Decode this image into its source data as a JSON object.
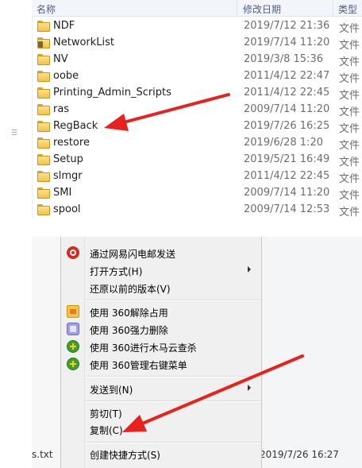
{
  "explorer": {
    "columns": {
      "name": "名称",
      "date": "修改日期",
      "type": "类型"
    },
    "rows": [
      {
        "name": "NDF",
        "date": "2019/7/12 21:36",
        "type": "文件"
      },
      {
        "name": "NetworkList",
        "date": "2019/7/14 11:20",
        "type": "文件",
        "locked": true
      },
      {
        "name": "NV",
        "date": "2019/3/8 15:36",
        "type": "文件"
      },
      {
        "name": "oobe",
        "date": "2011/4/12 22:47",
        "type": "文件"
      },
      {
        "name": "Printing_Admin_Scripts",
        "date": "2011/4/12 22:45",
        "type": "文件"
      },
      {
        "name": "ras",
        "date": "2009/7/14 11:20",
        "type": "文件"
      },
      {
        "name": "RegBack",
        "date": "2019/7/26 16:25",
        "type": "文件"
      },
      {
        "name": "restore",
        "date": "2019/6/28 1:20",
        "type": "文件"
      },
      {
        "name": "Setup",
        "date": "2019/5/21 16:49",
        "type": "文件"
      },
      {
        "name": "slmgr",
        "date": "2011/4/12 22:45",
        "type": "文件"
      },
      {
        "name": "SMI",
        "date": "2009/7/14 11:20",
        "type": "文件"
      },
      {
        "name": "spool",
        "date": "2009/7/14 12:53",
        "type": "文件"
      }
    ]
  },
  "context_menu": {
    "items": [
      {
        "label": "通过网易闪电邮发送",
        "icon": "netease-mail-icon"
      },
      {
        "label": "打开方式(H)",
        "submenu": true
      },
      {
        "label": "还原以前的版本(V)"
      },
      {
        "label": "使用 360解除占用",
        "icon": "unlock-icon"
      },
      {
        "label": "使用 360强力删除",
        "icon": "shred-icon"
      },
      {
        "label": "使用 360进行木马云查杀",
        "icon": "360-scan-icon"
      },
      {
        "label": "使用 360管理右键菜单",
        "icon": "360-menu-icon"
      },
      {
        "label": "发送到(N)",
        "submenu": true
      },
      {
        "label": "剪切(T)"
      },
      {
        "label": "复制(C)"
      },
      {
        "label": "创建快捷方式(S)"
      }
    ]
  },
  "behind_file": {
    "name": "s.txt",
    "date": "2019/7/26 16:27"
  },
  "colors": {
    "arrow": "#e8211c",
    "header_text": "#4d6185"
  }
}
